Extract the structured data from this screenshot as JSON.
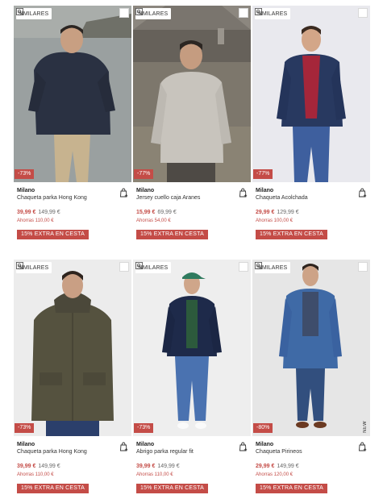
{
  "products": [
    {
      "similar_label": "SIMILARES",
      "discount": "-73%",
      "brand": "Milano",
      "name": "Chaqueta parka Hong Kong",
      "price": "39,99 €",
      "old_price": "149,99 €",
      "savings": "Ahorras 110,00 €",
      "extra": "15% EXTRA EN CESTA",
      "side_text": ""
    },
    {
      "similar_label": "SIMILARES",
      "discount": "-77%",
      "brand": "Milano",
      "name": "Jersey cuello caja Aranes",
      "price": "15,99 €",
      "old_price": "69,99 €",
      "savings": "Ahorras 54,00 €",
      "extra": "15% EXTRA EN CESTA",
      "side_text": ""
    },
    {
      "similar_label": "SIMILARES",
      "discount": "-77%",
      "brand": "Milano",
      "name": "Chaqueta Acolchada",
      "price": "29,99 €",
      "old_price": "129,99 €",
      "savings": "Ahorras 100,00 €",
      "extra": "15% EXTRA EN CESTA",
      "side_text": ""
    },
    {
      "similar_label": "SIMILARES",
      "discount": "-73%",
      "brand": "Milano",
      "name": "Chaqueta parka Hong Kong",
      "price": "39,99 €",
      "old_price": "149,99 €",
      "savings": "Ahorras 110,00 €",
      "extra": "15% EXTRA EN CESTA",
      "side_text": ""
    },
    {
      "similar_label": "SIMILARES",
      "discount": "-73%",
      "brand": "Milano",
      "name": "Abrigo parka regular fit",
      "price": "39,99 €",
      "old_price": "149,99 €",
      "savings": "Ahorras 110,00 €",
      "extra": "15% EXTRA EN CESTA",
      "side_text": ""
    },
    {
      "similar_label": "SIMILARES",
      "discount": "-80%",
      "brand": "Milano",
      "name": "Chaqueta Pirineos",
      "price": "29,99 €",
      "old_price": "149,99 €",
      "savings": "Ahorras 120,00 €",
      "extra": "15% EXTRA EN CESTA",
      "side_text": "NEW"
    }
  ],
  "colors": {
    "accent": "#c44c47",
    "photo_backgrounds": [
      "#8d9292",
      "#7a7670",
      "#e9e9ee",
      "#ececec",
      "#eeeeee",
      "#e6e6e6"
    ],
    "garments": [
      "#2a3142",
      "#c8c4bd",
      "#283960",
      "#55523f",
      "#1e2a4a",
      "#3f6aa6"
    ]
  },
  "icons": {
    "similar": "similar-search-icon",
    "favorite": "favorite-checkbox",
    "bag": "add-to-bag-icon"
  }
}
